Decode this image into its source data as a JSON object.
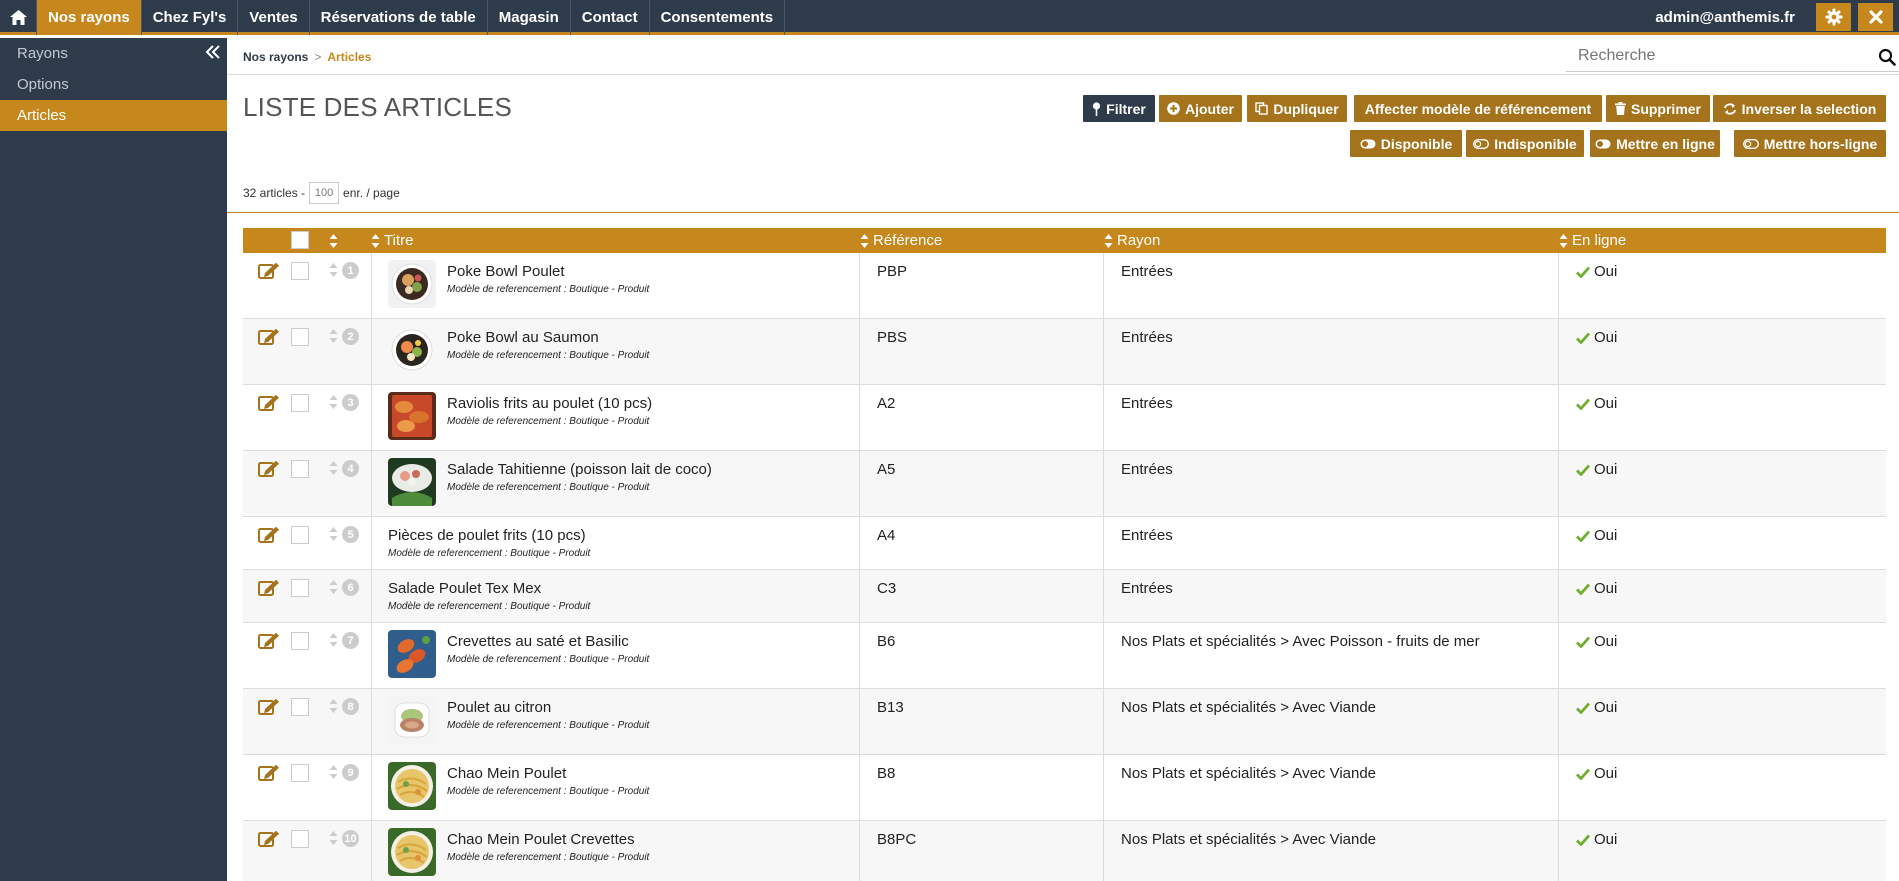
{
  "topnav": {
    "items": [
      "Nos rayons",
      "Chez Fyl's",
      "Ventes",
      "Réservations de table",
      "Magasin",
      "Contact",
      "Consentements"
    ],
    "active_index": 0,
    "user": "admin@anthemis.fr"
  },
  "sidebar": {
    "items": [
      "Rayons",
      "Options",
      "Articles"
    ],
    "active_index": 2
  },
  "breadcrumb": {
    "parent": "Nos rayons",
    "current": "Articles"
  },
  "search": {
    "placeholder": "Recherche"
  },
  "page_title": "LISTE DES ARTICLES",
  "toolbar": {
    "filter": "Filtrer",
    "add": "Ajouter",
    "duplicate": "Dupliquer",
    "assign_model": "Affecter modèle de référencement",
    "delete": "Supprimer",
    "invert": "Inverser la selection",
    "available": "Disponible",
    "unavailable": "Indisponible",
    "online": "Mettre en ligne",
    "offline": "Mettre hors-ligne"
  },
  "pagination": {
    "count_label": "32 articles -",
    "per_page": "100",
    "per_page_suffix": "enr. / page"
  },
  "table": {
    "columns": {
      "title": "Titre",
      "reference": "Référence",
      "rayon": "Rayon",
      "online": "En ligne"
    },
    "rows": [
      {
        "num": "1",
        "title": "Poke Bowl Poulet",
        "meta": "Modèle de referencement : Boutique - Produit",
        "ref": "PBP",
        "rayon": "Entrées",
        "online": "Oui",
        "thumb": "bowl-chicken"
      },
      {
        "num": "2",
        "title": "Poke Bowl au Saumon",
        "meta": "Modèle de referencement : Boutique - Produit",
        "ref": "PBS",
        "rayon": "Entrées",
        "online": "Oui",
        "thumb": "bowl-salmon"
      },
      {
        "num": "3",
        "title": "Raviolis frits au poulet (10 pcs)",
        "meta": "Modèle de referencement : Boutique - Produit",
        "ref": "A2",
        "rayon": "Entrées",
        "online": "Oui",
        "thumb": "fried-ravioli"
      },
      {
        "num": "4",
        "title": "Salade Tahitienne (poisson lait de coco)",
        "meta": "Modèle de referencement : Boutique - Produit",
        "ref": "A5",
        "rayon": "Entrées",
        "online": "Oui",
        "thumb": "tahitian-salad"
      },
      {
        "num": "5",
        "title": "Pièces de poulet frits (10 pcs)",
        "meta": "Modèle de referencement : Boutique - Produit",
        "ref": "A4",
        "rayon": "Entrées",
        "online": "Oui",
        "thumb": ""
      },
      {
        "num": "6",
        "title": "Salade Poulet Tex Mex",
        "meta": "Modèle de referencement : Boutique - Produit",
        "ref": "C3",
        "rayon": "Entrées",
        "online": "Oui",
        "thumb": ""
      },
      {
        "num": "7",
        "title": "Crevettes au saté et Basilic",
        "meta": "Modèle de referencement : Boutique - Produit",
        "ref": "B6",
        "rayon": "Nos Plats et spécialités > Avec Poisson - fruits de mer",
        "online": "Oui",
        "thumb": "shrimp-sate"
      },
      {
        "num": "8",
        "title": "Poulet au citron",
        "meta": "Modèle de referencement : Boutique - Produit",
        "ref": "B13",
        "rayon": "Nos Plats et spécialités > Avec Viande",
        "online": "Oui",
        "thumb": "lemon-chicken"
      },
      {
        "num": "9",
        "title": "Chao Mein Poulet",
        "meta": "Modèle de referencement : Boutique - Produit",
        "ref": "B8",
        "rayon": "Nos Plats et spécialités > Avec Viande",
        "online": "Oui",
        "thumb": "noodles"
      },
      {
        "num": "10",
        "title": "Chao Mein Poulet Crevettes",
        "meta": "Modèle de referencement : Boutique - Produit",
        "ref": "B8PC",
        "rayon": "Nos Plats et spécialités > Avec Viande",
        "online": "Oui",
        "thumb": "noodles"
      }
    ]
  },
  "colors": {
    "accent": "#c6871c",
    "button": "#a4731b",
    "navy": "#2e3b4a",
    "check_green": "#6fae2e"
  }
}
